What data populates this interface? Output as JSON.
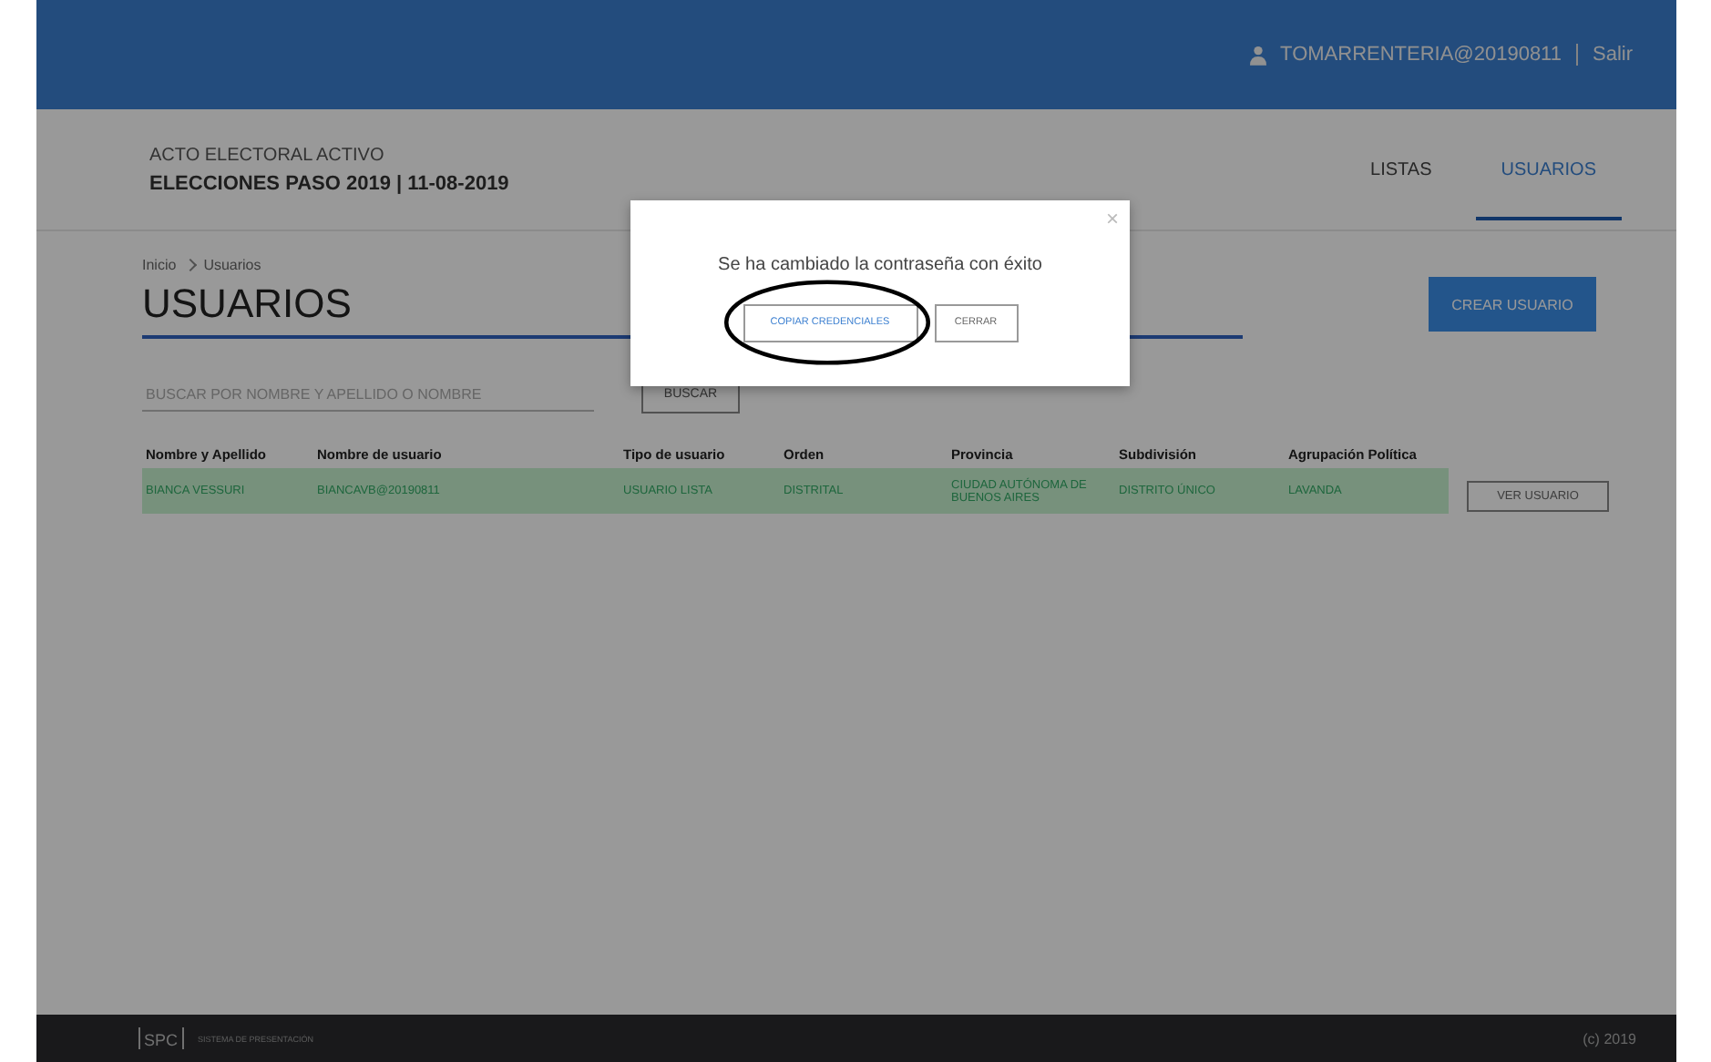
{
  "top_bar": {
    "user": "TOMARRENTERIA@20190811",
    "logout": "Salir"
  },
  "header": {
    "caption": "ACTO ELECTORAL ACTIVO",
    "election": "ELECCIONES PASO 2019 | 11-08-2019"
  },
  "tabs": [
    {
      "label": "LISTAS",
      "selected": false
    },
    {
      "label": "USUARIOS",
      "selected": true
    }
  ],
  "breadcrumb": [
    "Inicio",
    "Usuarios"
  ],
  "page_title": "USUARIOS",
  "create_button": "CREAR USUARIO",
  "search": {
    "placeholder": "BUSCAR POR NOMBRE Y APELLIDO O NOMBRE",
    "button": "BUSCAR"
  },
  "table": {
    "columns": [
      "Nombre y Apellido",
      "Nombre de usuario",
      "Tipo de usuario",
      "Orden",
      "Provincia",
      "Subdivisión",
      "Agrupación Política"
    ],
    "rows": [
      {
        "cells": [
          "BIANCA VESSURI",
          "BIANCAVB@20190811",
          "USUARIO LISTA",
          "DISTRITAL",
          "CIUDAD AUTÓNOMA DE BUENOS AIRES",
          "DISTRITO ÚNICO",
          "LAVANDA"
        ],
        "action": "VER USUARIO",
        "selected": true
      }
    ]
  },
  "modal": {
    "close": "×",
    "message": "Se ha cambiado la contraseña con éxito",
    "buttons": [
      {
        "label": "COPIAR CREDENCIALES",
        "kind": "primary",
        "circled": true
      },
      {
        "label": "CERRAR",
        "kind": "secondary",
        "circled": false
      }
    ]
  },
  "footer": {
    "logo": "SPC",
    "system": "SISTEMA DE PRESENTACIÓN",
    "copyright": "(c) 2019"
  }
}
